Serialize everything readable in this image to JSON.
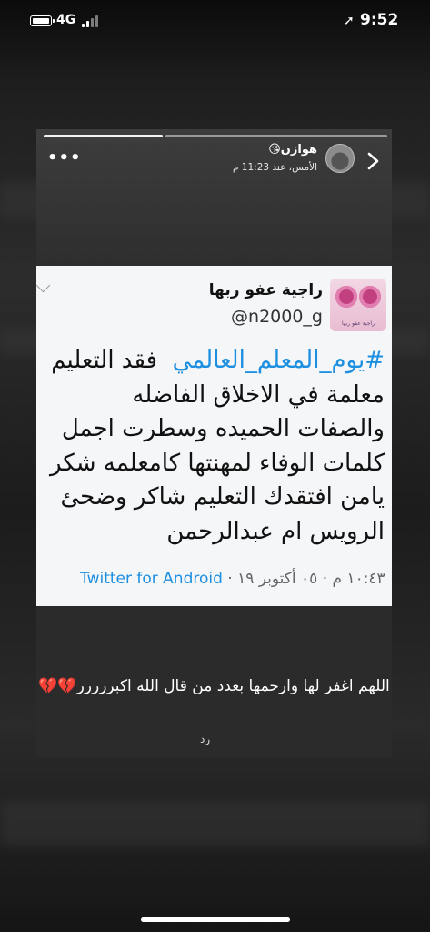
{
  "status_bar": {
    "network": "4G",
    "time": "9:52"
  },
  "story": {
    "username": "هوازن😘",
    "posted_time": "الأمس، عند 11:23 م",
    "more_label": "•••",
    "progress": [
      1.0,
      0.0
    ]
  },
  "tweet": {
    "display_name": "راجية عفو ربها",
    "handle": "@n2000_g",
    "logo_text": "راجية عفو ربها",
    "hashtag": "#يوم_المعلم_العالمي",
    "body": "فقد التعليم معلمة في الاخلاق الفاضله والصفات الحميده وسطرت اجمل كلمات الوفاء لمهنتها كامعلمه شكر يامن افتقدك التعليم شاكر وضحئ الرويس ام عبدالرحمن",
    "timestamp": "١٠:٤٣ م · ٠٥ أكتوبر ١٩ · ",
    "source": "Twitter for Android"
  },
  "caption": {
    "text": "اللهم اغفر لها وارحمها بعدد من قال الله اكبررررر",
    "emoji": "💔💔",
    "reply_label": "رد"
  },
  "colors": {
    "hashtag": "#1d8fe0",
    "hearts": "#d8223a"
  }
}
